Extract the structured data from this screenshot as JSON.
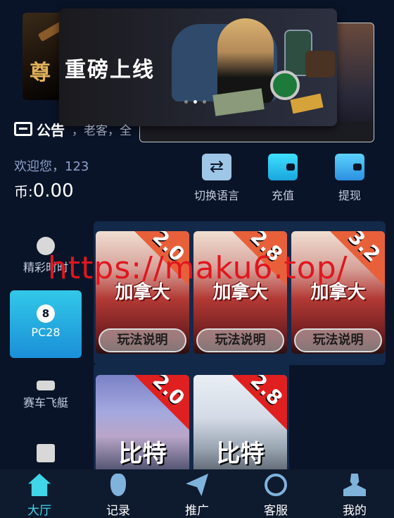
{
  "banner": {
    "title": "重磅上线",
    "dots_count": 3,
    "active_dot": 2,
    "background_card_text": "尊"
  },
  "notice": {
    "label": "公告",
    "text": "，老客，全"
  },
  "user": {
    "welcome": "欢迎您，123",
    "currency_label": "币:",
    "balance": "0.00"
  },
  "quick_actions": [
    {
      "label": "切换语言",
      "icon": "swap-language-icon"
    },
    {
      "label": "充值",
      "icon": "wallet-icon"
    },
    {
      "label": "提现",
      "icon": "wallet-withdraw-icon"
    }
  ],
  "categories": [
    {
      "label": "精彩时时",
      "icon": "timer-icon",
      "active": false
    },
    {
      "label": "PC28",
      "icon": "billiard-ball-icon",
      "active": true
    },
    {
      "label": "赛车飞艇",
      "icon": "speedboat-icon",
      "active": false
    },
    {
      "label": "",
      "icon": "cards-icon",
      "active": false
    }
  ],
  "games": [
    {
      "name": "加拿大",
      "odds": "2.0",
      "rules": "玩法说明"
    },
    {
      "name": "加拿大",
      "odds": "2.8",
      "rules": "玩法说明"
    },
    {
      "name": "加拿大",
      "odds": "3.2",
      "rules": "玩法说明"
    },
    {
      "name": "比特",
      "odds": "2.0"
    },
    {
      "name": "比特",
      "odds": "2.8"
    }
  ],
  "watermark": "https://maku6.top/",
  "tabs": [
    {
      "label": "大厅",
      "icon": "home-icon",
      "active": true
    },
    {
      "label": "记录",
      "icon": "footprint-icon",
      "active": false
    },
    {
      "label": "推广",
      "icon": "paper-plane-icon",
      "active": false
    },
    {
      "label": "客服",
      "icon": "headset-icon",
      "active": false
    },
    {
      "label": "我的",
      "icon": "user-icon",
      "active": false
    }
  ],
  "colors": {
    "background": "#0a1428",
    "accent": "#3fd6e8",
    "watermark": "#e0161e"
  }
}
